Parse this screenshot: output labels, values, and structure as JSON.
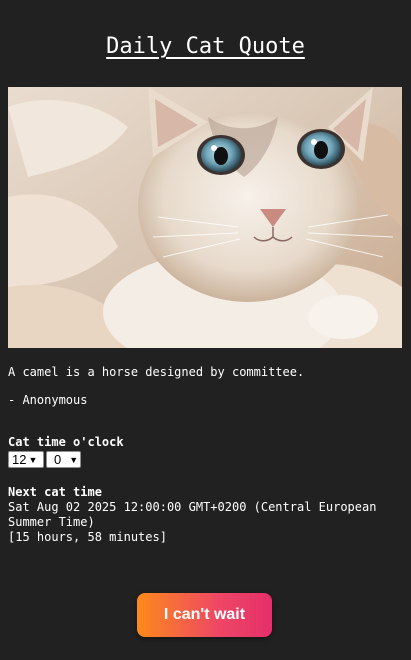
{
  "header": {
    "title": "Daily Cat Quote"
  },
  "quote": {
    "text": "A camel is a horse designed by committee.",
    "author": "- Anonymous"
  },
  "cat_time": {
    "label": "Cat time o'clock",
    "hour": "12",
    "minute": "0"
  },
  "next": {
    "label": "Next cat time",
    "datetime": "Sat Aug 02 2025 12:00:00 GMT+0200 (Central European Summer Time)",
    "countdown": "[15 hours, 58 minutes]"
  },
  "cta": {
    "label": "I can't wait"
  },
  "colors": {
    "background": "#212121",
    "button_gradient_start": "#fd8a1a",
    "button_gradient_end": "#e52f6a"
  }
}
